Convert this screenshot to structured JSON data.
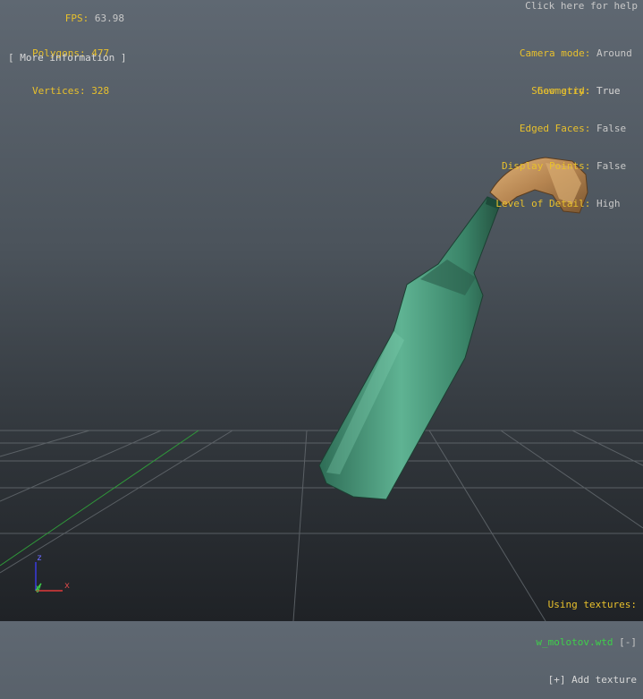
{
  "stats": {
    "fps_label": "FPS:",
    "fps_value": "63.98",
    "polygons_label": "Polygons:",
    "polygons_value": "477",
    "vertices_label": "Vertices:",
    "vertices_value": "328",
    "more_info": "[ More information ]"
  },
  "help": "Click here for help",
  "settings": {
    "camera_mode_label": "Camera mode:",
    "camera_mode_value": "Around",
    "show_grid_label": "Show grid:",
    "show_grid_value": "True",
    "geometry_label": "Geometry:",
    "geometry_value": "True",
    "edged_faces_label": "Edged Faces:",
    "edged_faces_value": "False",
    "display_points_label": "Display Points:",
    "display_points_value": "False",
    "lod_label": "Level of Detail:",
    "lod_value": "High"
  },
  "textures": {
    "heading": "Using textures:",
    "items": [
      {
        "name": "w_molotov.wtd",
        "toggle": "[-]"
      }
    ],
    "add": "[+] Add texture"
  },
  "axes": {
    "z": "z",
    "y": "y",
    "x": "x"
  },
  "colors": {
    "label": "#e8c02c",
    "value": "#c8c8c8",
    "texture": "#3ed04a",
    "bottle": "#3f8f72",
    "rag": "#c79a5e"
  }
}
